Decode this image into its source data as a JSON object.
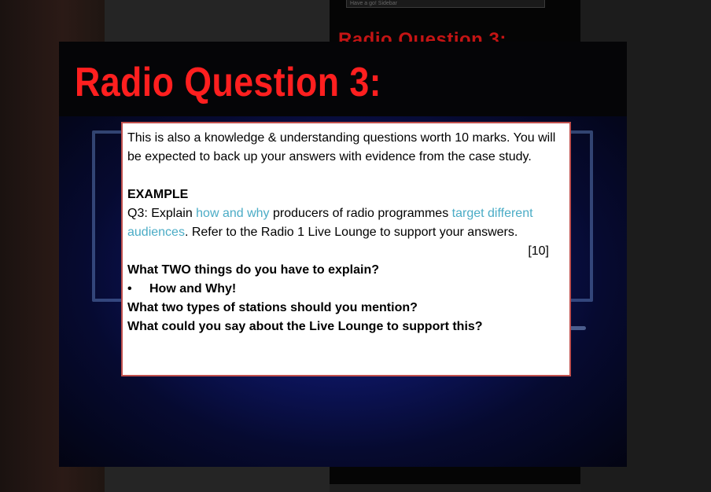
{
  "background": {
    "input_text": "Have a go! Sidebar",
    "back_title": "Radio Question 3:"
  },
  "slide": {
    "title": "Radio Question 3:",
    "intro": "This is also a knowledge & understanding questions worth 10 marks. You will be expected to back up your answers with evidence from the case study.",
    "example_heading": "EXAMPLE",
    "question": {
      "prefix": "Q3: Explain ",
      "hl1": "how and why",
      "mid": " producers of radio programmes ",
      "hl2": "target different audiences",
      "suffix": ". Refer to the Radio 1 Live Lounge to support your answers."
    },
    "marks": "[10]",
    "prompt1": "What TWO things do you have to explain?",
    "bullet_symbol": "•",
    "bullet_text": "How and Why!",
    "prompt2": "What two types of stations should you mention?",
    "prompt3": "What could you say about the Live Lounge to support this?"
  },
  "colors": {
    "title_red": "#ff1f1f",
    "highlight_blue": "#4bacc6",
    "box_border": "#c0504d"
  }
}
